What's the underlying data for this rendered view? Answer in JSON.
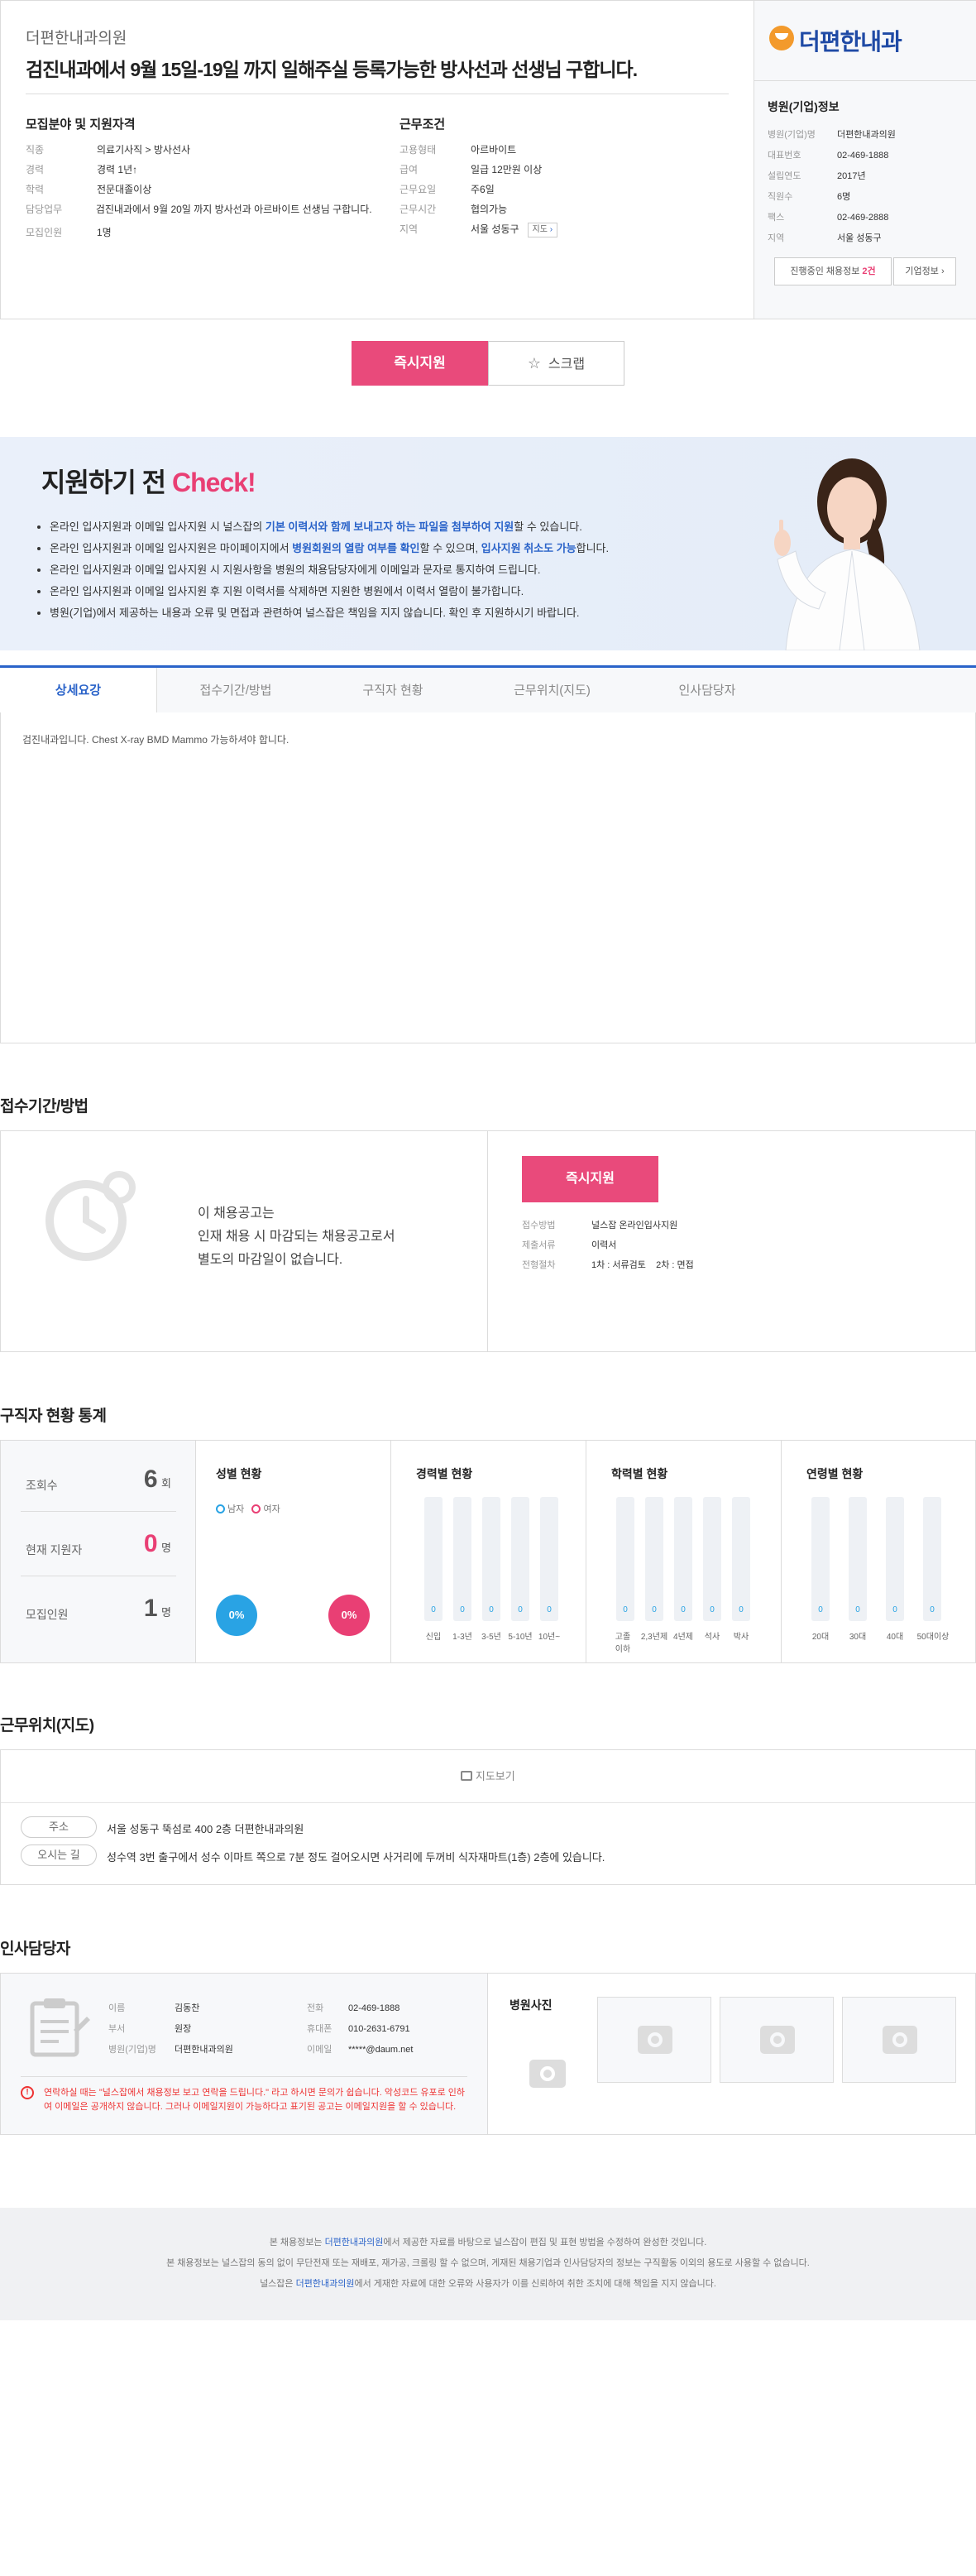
{
  "header": {
    "company": "더편한내과의원",
    "title": "검진내과에서 9월 15일-19일 까지 일해주실 등록가능한 방사선과 선생님 구합니다."
  },
  "recruit": {
    "heading": "모집분야 및 지원자격",
    "rows": [
      {
        "k": "직종",
        "v": "의료기사직 > 방사선사"
      },
      {
        "k": "경력",
        "v": "경력 1년↑"
      },
      {
        "k": "학력",
        "v": "전문대졸이상"
      },
      {
        "k": "담당업무",
        "v": "검진내과에서 9월 20일 까지 방사선과 아르바이트 선생님 구합니다."
      },
      {
        "k": "모집인원",
        "v": "1명"
      }
    ]
  },
  "conditions": {
    "heading": "근무조건",
    "rows": [
      {
        "k": "고용형태",
        "v": "아르바이트"
      },
      {
        "k": "급여",
        "v": "일급 12만원 이상"
      },
      {
        "k": "근무요일",
        "v": "주6일"
      },
      {
        "k": "근무시간",
        "v": "협의가능"
      },
      {
        "k": "지역",
        "v": "서울 성동구"
      }
    ],
    "map_btn": "지도"
  },
  "hospital": {
    "logo": "더편한내과",
    "heading": "병원(기업)정보",
    "rows": [
      {
        "k": "병원(기업)명",
        "v": "더편한내과의원"
      },
      {
        "k": "대표번호",
        "v": "02-469-1888"
      },
      {
        "k": "설립연도",
        "v": "2017년"
      },
      {
        "k": "직원수",
        "v": "6명"
      },
      {
        "k": "팩스",
        "v": "02-469-2888"
      },
      {
        "k": "지역",
        "v": "서울 성동구"
      }
    ],
    "btn_jobs_pre": "진행중인 채용정보",
    "btn_jobs_count": "2건",
    "btn_info": "기업정보"
  },
  "actions": {
    "apply": "즉시지원",
    "scrap": "스크랩"
  },
  "check": {
    "title_a": "지원하기 전 ",
    "title_b": "Check!",
    "items": [
      [
        "온라인 입사지원과 이메일 입사지원 시 널스잡의 ",
        "기본 이력서와 함께 보내고자 하는 파일을 첨부하여 지원",
        "할 수 있습니다.",
        "",
        ""
      ],
      [
        "온라인 입사지원과 이메일 입사지원은 마이페이지에서 ",
        "병원회원의 열람 여부를 확인",
        "할 수 있으며, ",
        "입사지원 취소도 가능",
        "합니다."
      ],
      [
        "온라인 입사지원과 이메일 입사지원 시 지원사항을 병원의 채용담당자에게 이메일과 문자로 통지하여 드립니다.",
        "",
        "",
        "",
        ""
      ],
      [
        "온라인 입사지원과 이메일 입사지원 후 지원 이력서를 삭제하면 지원한 병원에서 이력서 열람이 불가합니다.",
        "",
        "",
        "",
        ""
      ],
      [
        "병원(기업)에서 제공하는 내용과 오류 및 면접과 관련하여 널스잡은 책임을 지지 않습니다. 확인 후 지원하시기 바랍니다.",
        "",
        "",
        "",
        ""
      ]
    ]
  },
  "tabs": [
    "상세요강",
    "접수기간/방법",
    "구직자 현황",
    "근무위치(지도)",
    "인사담당자"
  ],
  "detail_text": "검진내과입니다.  Chest X-ray BMD Mammo 가능하셔야 합니다.",
  "period": {
    "heading": "접수기간/방법",
    "msg": [
      "이 채용공고는",
      "인재 채용 시 마감되는 채용공고로서",
      "별도의 마감일이 없습니다."
    ],
    "apply": "즉시지원",
    "rows": [
      {
        "k": "접수방법",
        "v": "널스잡 온라인입사지원"
      },
      {
        "k": "제출서류",
        "v": "이력서"
      },
      {
        "k": "전형절차",
        "v": "1차 : 서류검토    2차 : 면접"
      }
    ]
  },
  "stats": {
    "heading": "구직자 현황 통계",
    "views_label": "조회수",
    "views": "6",
    "views_unit": "회",
    "applicants_label": "현재 지원자",
    "applicants": "0",
    "applicants_unit": "명",
    "recruit_label": "모집인원",
    "recruit": "1",
    "recruit_unit": "명",
    "gender": {
      "title": "성별 현황",
      "male": "남자",
      "female": "여자",
      "male_pct": "0%",
      "female_pct": "0%"
    },
    "career": {
      "title": "경력별 현황",
      "labels": [
        "신입",
        "1-3년",
        "3-5년",
        "5-10년",
        "10년~"
      ],
      "values": [
        "0",
        "0",
        "0",
        "0",
        "0"
      ]
    },
    "edu": {
      "title": "학력별 현황",
      "labels": [
        "고졸 이하",
        "2,3년제",
        "4년제",
        "석사",
        "박사"
      ],
      "values": [
        "0",
        "0",
        "0",
        "0",
        "0"
      ]
    },
    "age": {
      "title": "연령별 현황",
      "labels": [
        "20대",
        "30대",
        "40대",
        "50대이상"
      ],
      "values": [
        "0",
        "0",
        "0",
        "0"
      ]
    },
    "colors": {
      "blue": "#29a3e4",
      "pink": "#e93f74"
    }
  },
  "location": {
    "heading": "근무위치(지도)",
    "map_view": "지도보기",
    "addr_label": "주소",
    "addr": "서울 성동구 뚝섬로 400 2층 더편한내과의원",
    "route_label": "오시는 길",
    "route": "성수역 3번 출구에서 성수 이마트 쪽으로 7분 정도 걸어오시면 사거리에 두꺼비 식자재마트(1층) 2층에 있습니다."
  },
  "contact": {
    "heading": "인사담당자",
    "rows_left": [
      {
        "k": "이름",
        "v": "김동찬"
      },
      {
        "k": "부서",
        "v": "원장"
      },
      {
        "k": "병원(기업)명",
        "v": "더편한내과의원"
      }
    ],
    "rows_right": [
      {
        "k": "전화",
        "v": "02-469-1888"
      },
      {
        "k": "휴대폰",
        "v": "010-2631-6791"
      },
      {
        "k": "이메일",
        "v": "*****@daum.net"
      }
    ],
    "notice": "연락하실 때는 \"널스잡에서 채용정보 보고 연락을 드립니다.\" 라고 하시면 문의가 쉽습니다. 악성코드 유포로 인하여 이메일은 공개하지 않습니다. 그러나 이메일지원이 가능하다고 표기된 공고는 이메일지원을 할 수 있습니다.",
    "photo_heading": "병원사진"
  },
  "footer": {
    "l1a": "본 채용정보는 ",
    "l1b": "더편한내과의원",
    "l1c": "에서 제공한 자료를 바탕으로 널스잡이 편집 및 표현 방법을 수정하여 완성한 것입니다.",
    "l2": "본 채용정보는 널스잡의 동의 없이 무단전재 또는 재배포, 재가공, 크롤링 할 수 없으며, 게재된 채용기업과 인사담당자의 정보는 구직활동 이외의 용도로 사용할 수 없습니다.",
    "l3a": "널스잡은 ",
    "l3b": "더편한내과의원",
    "l3c": "에서 게재한 자료에 대한 오류와 사용자가 이를 신뢰하여 취한 조치에 대해 책임을 지지 않습니다."
  }
}
